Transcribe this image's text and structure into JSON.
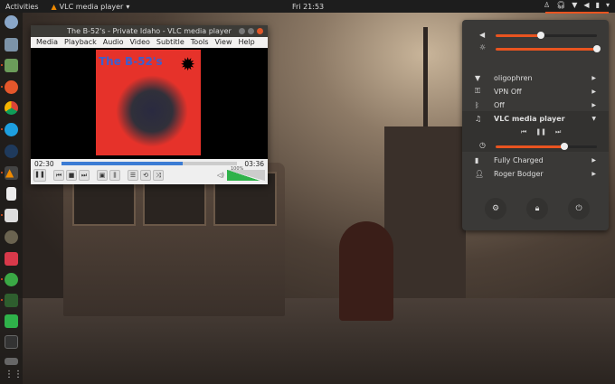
{
  "topbar": {
    "activities": "Activities",
    "app_name": "VLC media player",
    "app_icon": "vlc-cone-icon",
    "clock": "Fri 21:53",
    "tray_icons": [
      "accessibility-icon",
      "headphones-icon",
      "wifi-icon",
      "volume-icon",
      "battery-icon",
      "chevron-down-icon"
    ]
  },
  "dock": {
    "items": [
      "settings",
      "screenshot",
      "files-archive",
      "firefox",
      "chrome",
      "skype",
      "steam",
      "vlc",
      "document",
      "pdf-editor",
      "gimp",
      "app-grid-red",
      "android-studio",
      "nvidia",
      "file-manager",
      "terminal",
      "toolbox",
      "show-applications"
    ]
  },
  "vlc": {
    "title": "The B-52's - Private Idaho - VLC media player",
    "menu": [
      "Media",
      "Playback",
      "Audio",
      "Video",
      "Subtitle",
      "Tools",
      "View",
      "Help"
    ],
    "album_text": "The B-52's",
    "elapsed": "02:30",
    "total": "03:36",
    "progress": 0.69,
    "volume_label": "100%",
    "volume": 1.0
  },
  "panel": {
    "volume": 0.45,
    "brightness": 1.0,
    "wifi": "oligophren",
    "vpn": "VPN Off",
    "bluetooth": "Off",
    "media_player": "VLC media player",
    "media_progress": 0.68,
    "battery": "Fully Charged",
    "user": "Roger Bodger",
    "accent": "#e95420"
  }
}
